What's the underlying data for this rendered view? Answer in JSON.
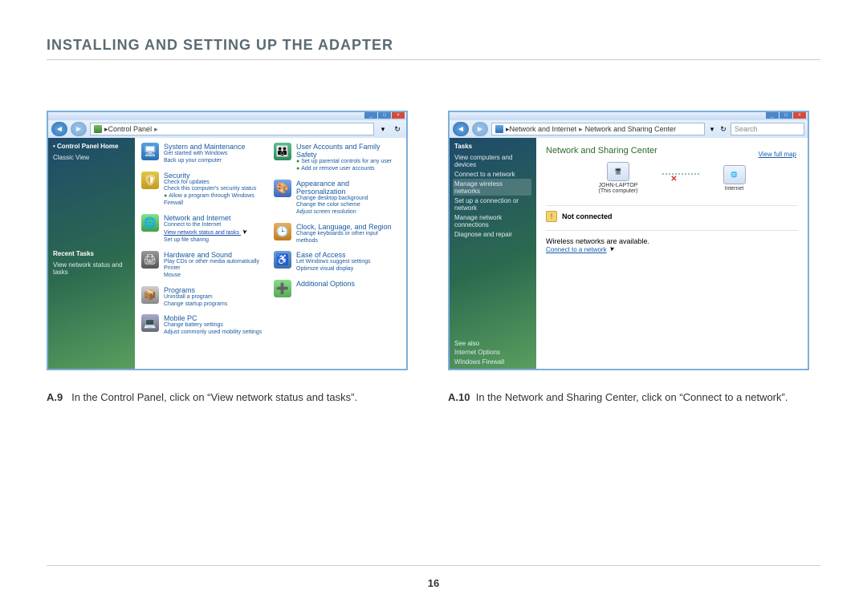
{
  "page_title": "INSTALLING AND SETTING UP THE ADAPTER",
  "page_number": "16",
  "caption_left": {
    "tag": "A.9",
    "text": "In the Control Panel, click on “View network status and tasks”."
  },
  "caption_right": {
    "tag": "A.10",
    "text": "In the Network and Sharing Center, click on “Connect to a network”."
  },
  "left": {
    "breadcrumb": "Control Panel",
    "sidebar": {
      "home": "Control Panel Home",
      "classic": "Classic View",
      "recent_hdr": "Recent Tasks",
      "recent_item": "View network status and tasks"
    },
    "cats": {
      "sys": {
        "t": "System and Maintenance",
        "s1": "Get started with Windows",
        "s2": "Back up your computer"
      },
      "sec": {
        "t": "Security",
        "s1": "Check for updates",
        "s2": "Check this computer's security status",
        "s3": "Allow a program through Windows Firewall"
      },
      "net": {
        "t": "Network and Internet",
        "s1": "Connect to the Internet",
        "s2": "View network status and tasks",
        "s3": "Set up file sharing"
      },
      "hw": {
        "t": "Hardware and Sound",
        "s1": "Play CDs or other media automatically",
        "s2": "Printer",
        "s3": "Mouse"
      },
      "prog": {
        "t": "Programs",
        "s1": "Uninstall a program",
        "s2": "Change startup programs"
      },
      "mob": {
        "t": "Mobile PC",
        "s1": "Change battery settings",
        "s2": "Adjust commonly used mobility settings"
      },
      "user": {
        "t": "User Accounts and Family Safety",
        "s1": "Set up parental controls for any user",
        "s2": "Add or remove user accounts"
      },
      "appr": {
        "t": "Appearance and Personalization",
        "s1": "Change desktop background",
        "s2": "Change the color scheme",
        "s3": "Adjust screen resolution"
      },
      "clock": {
        "t": "Clock, Language, and Region",
        "s1": "Change keyboards or other input methods"
      },
      "ease": {
        "t": "Ease of Access",
        "s1": "Let Windows suggest settings",
        "s2": "Optimize visual display"
      },
      "add": {
        "t": "Additional Options"
      }
    }
  },
  "right": {
    "breadcrumb1": "Network and Internet",
    "breadcrumb2": "Network and Sharing Center",
    "search_placeholder": "Search",
    "sidebar": {
      "hdr": "Tasks",
      "items": [
        "View computers and devices",
        "Connect to a network",
        "Manage wireless networks",
        "Set up a connection or network",
        "Manage network connections",
        "Diagnose and repair"
      ],
      "seealso": "See also",
      "seealso_items": [
        "Internet Options",
        "Windows Firewall"
      ]
    },
    "nsc_title": "Network and Sharing Center",
    "viewmap": "View full map",
    "node1": {
      "name": "JOHN-LAPTOP",
      "sub": "(This computer)"
    },
    "node2": "Internet",
    "status": "Not connected",
    "wireless_msg": "Wireless networks are available.",
    "connect_link": "Connect to a network"
  }
}
